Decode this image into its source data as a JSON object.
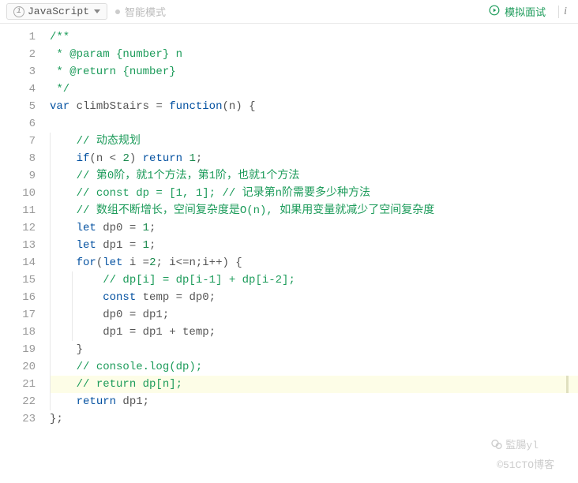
{
  "toolbar": {
    "language": "JavaScript",
    "mode_label": "智能模式",
    "interview_btn": "模拟面试",
    "info_char": "i"
  },
  "code": {
    "total_lines": 23,
    "highlighted_line": 21,
    "lines": [
      {
        "tokens": [
          {
            "t": "/**",
            "c": "c-comment"
          }
        ]
      },
      {
        "tokens": [
          {
            "t": " * @param {number} n",
            "c": "c-comment"
          }
        ]
      },
      {
        "tokens": [
          {
            "t": " * @return {number}",
            "c": "c-comment"
          }
        ]
      },
      {
        "tokens": [
          {
            "t": " */",
            "c": "c-comment"
          }
        ]
      },
      {
        "tokens": [
          {
            "t": "var",
            "c": "c-keyword"
          },
          {
            "t": " ",
            "c": "c-text"
          },
          {
            "t": "climbStairs",
            "c": "c-text"
          },
          {
            "t": " = ",
            "c": "c-text"
          },
          {
            "t": "function",
            "c": "c-keyword"
          },
          {
            "t": "(n) {",
            "c": "c-text"
          }
        ]
      },
      {
        "tokens": []
      },
      {
        "indent": 1,
        "tokens": [
          {
            "t": "// 动态规划",
            "c": "c-comment"
          }
        ]
      },
      {
        "indent": 1,
        "tokens": [
          {
            "t": "if",
            "c": "c-keyword"
          },
          {
            "t": "(n < ",
            "c": "c-text"
          },
          {
            "t": "2",
            "c": "c-num"
          },
          {
            "t": ") ",
            "c": "c-text"
          },
          {
            "t": "return",
            "c": "c-keyword"
          },
          {
            "t": " ",
            "c": "c-text"
          },
          {
            "t": "1",
            "c": "c-num"
          },
          {
            "t": ";",
            "c": "c-text"
          }
        ]
      },
      {
        "indent": 1,
        "tokens": [
          {
            "t": "// 第0阶，就1个方法，第1阶，也就1个方法",
            "c": "c-comment"
          }
        ]
      },
      {
        "indent": 1,
        "tokens": [
          {
            "t": "// const dp = [1, 1]; // 记录第n阶需要多少种方法",
            "c": "c-comment"
          }
        ]
      },
      {
        "indent": 1,
        "tokens": [
          {
            "t": "// 数组不断增长，空间复杂度是O(n), 如果用变量就减少了空间复杂度",
            "c": "c-comment"
          }
        ]
      },
      {
        "indent": 1,
        "tokens": [
          {
            "t": "let",
            "c": "c-keyword"
          },
          {
            "t": " dp0 = ",
            "c": "c-text"
          },
          {
            "t": "1",
            "c": "c-num"
          },
          {
            "t": ";",
            "c": "c-text"
          }
        ]
      },
      {
        "indent": 1,
        "tokens": [
          {
            "t": "let",
            "c": "c-keyword"
          },
          {
            "t": " dp1 = ",
            "c": "c-text"
          },
          {
            "t": "1",
            "c": "c-num"
          },
          {
            "t": ";",
            "c": "c-text"
          }
        ]
      },
      {
        "indent": 1,
        "tokens": [
          {
            "t": "for",
            "c": "c-keyword"
          },
          {
            "t": "(",
            "c": "c-text"
          },
          {
            "t": "let",
            "c": "c-keyword"
          },
          {
            "t": " i =",
            "c": "c-text"
          },
          {
            "t": "2",
            "c": "c-num"
          },
          {
            "t": "; i<=n;i++) {",
            "c": "c-text"
          }
        ]
      },
      {
        "indent": 2,
        "tokens": [
          {
            "t": "// dp[i] = dp[i-1] + dp[i-2];",
            "c": "c-comment"
          }
        ]
      },
      {
        "indent": 2,
        "tokens": [
          {
            "t": "const",
            "c": "c-keyword"
          },
          {
            "t": " temp = dp0;",
            "c": "c-text"
          }
        ]
      },
      {
        "indent": 2,
        "tokens": [
          {
            "t": "dp0 = dp1;",
            "c": "c-text"
          }
        ]
      },
      {
        "indent": 2,
        "tokens": [
          {
            "t": "dp1 = dp1 + temp;",
            "c": "c-text"
          }
        ]
      },
      {
        "indent": 1,
        "tokens": [
          {
            "t": "}",
            "c": "c-text"
          }
        ]
      },
      {
        "indent": 1,
        "tokens": [
          {
            "t": "// console.log(dp);",
            "c": "c-comment"
          }
        ]
      },
      {
        "indent": 1,
        "tokens": [
          {
            "t": "// return dp[n];",
            "c": "c-comment"
          }
        ]
      },
      {
        "indent": 1,
        "tokens": [
          {
            "t": "return",
            "c": "c-keyword"
          },
          {
            "t": " dp1;",
            "c": "c-text"
          }
        ]
      },
      {
        "tokens": [
          {
            "t": "};",
            "c": "c-text"
          }
        ]
      }
    ]
  },
  "watermarks": {
    "w1": "監腸yl",
    "w2": "©51CTO博客"
  }
}
